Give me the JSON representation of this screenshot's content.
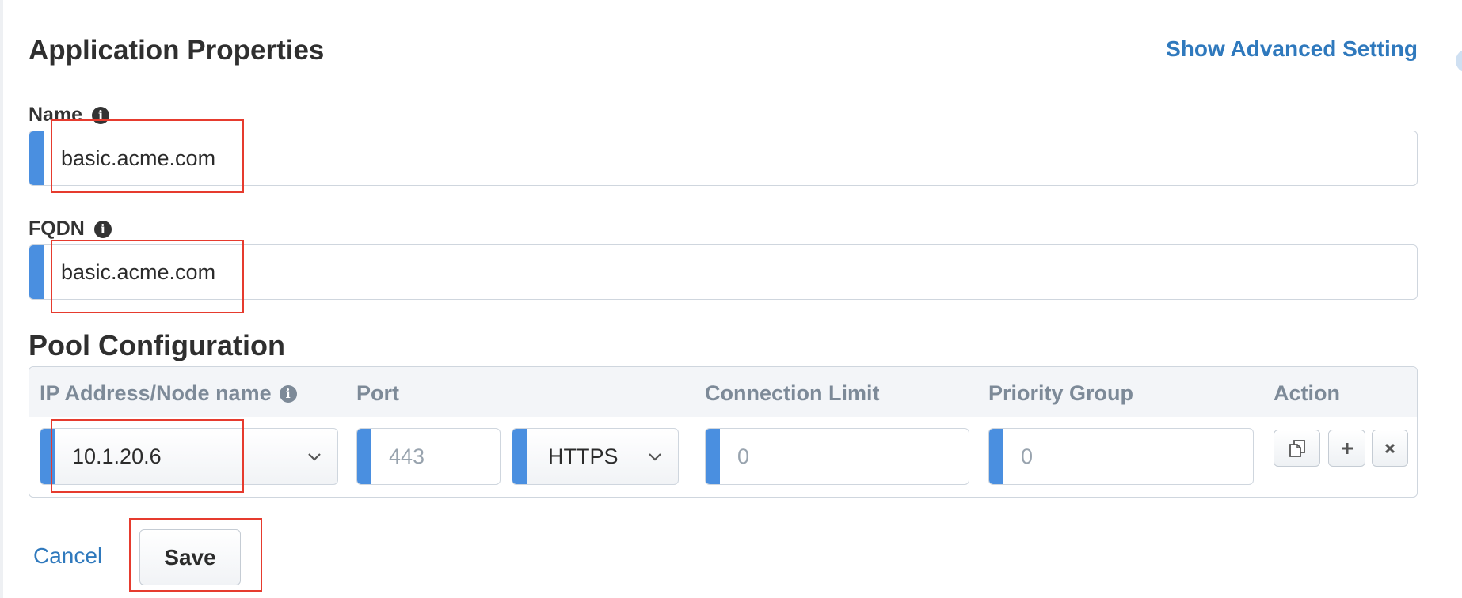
{
  "app_properties": {
    "title": "Application Properties",
    "advanced_link": "Show Advanced Setting",
    "name_label": "Name",
    "name_value": "basic.acme.com",
    "fqdn_label": "FQDN",
    "fqdn_value": "basic.acme.com"
  },
  "pool": {
    "title": "Pool Configuration",
    "columns": {
      "ip": "IP Address/Node name",
      "port": "Port",
      "connection_limit": "Connection Limit",
      "priority_group": "Priority Group",
      "action": "Action"
    },
    "row": {
      "ip_value": "10.1.20.6",
      "port_placeholder": "443",
      "protocol": "HTTPS",
      "connection_limit_placeholder": "0",
      "priority_group_placeholder": "0"
    },
    "action_icons": [
      "copy-icon",
      "plus-icon",
      "close-icon"
    ]
  },
  "footer": {
    "cancel_label": "Cancel",
    "save_label": "Save"
  },
  "colors": {
    "accent": "#4a8fe0",
    "link": "#2f79bd",
    "highlight": "#e63b2e"
  }
}
